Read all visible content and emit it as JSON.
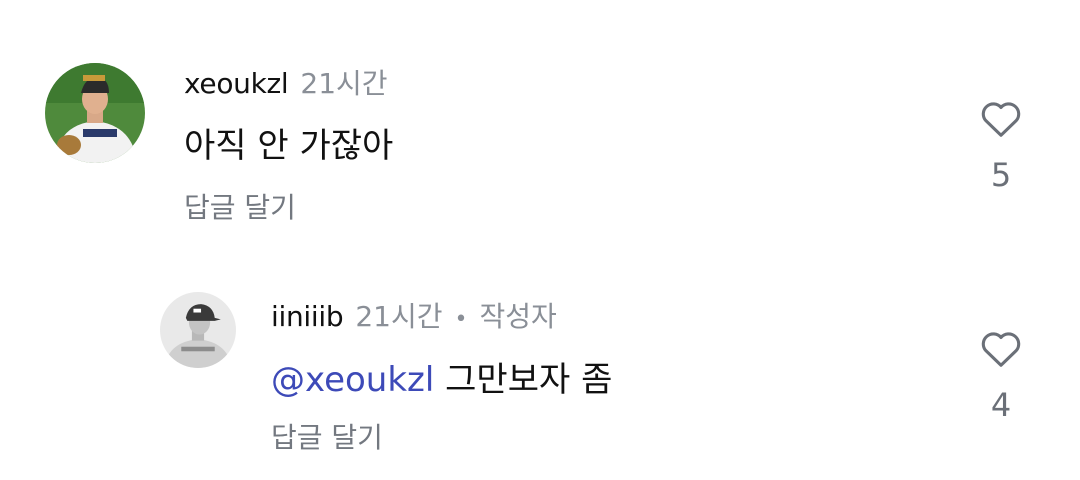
{
  "comments": [
    {
      "username": "xeoukzl",
      "time": "21시간",
      "body": "아직 안 가잖아",
      "reply_label": "답글 달기",
      "like_count": "5",
      "avatar": "baseball-player-photo-icon"
    }
  ],
  "replies": [
    {
      "username": "iiniiib",
      "time": "21시간",
      "separator": "•",
      "author_badge": "작성자",
      "mention": "@xeoukzl",
      "body": "그만보자 좀",
      "reply_label": "답글 달기",
      "like_count": "4",
      "avatar": "player-photo-icon"
    }
  ],
  "colors": {
    "mention": "#3d4ab8",
    "meta": "#8a8f97",
    "text": "#111111"
  }
}
